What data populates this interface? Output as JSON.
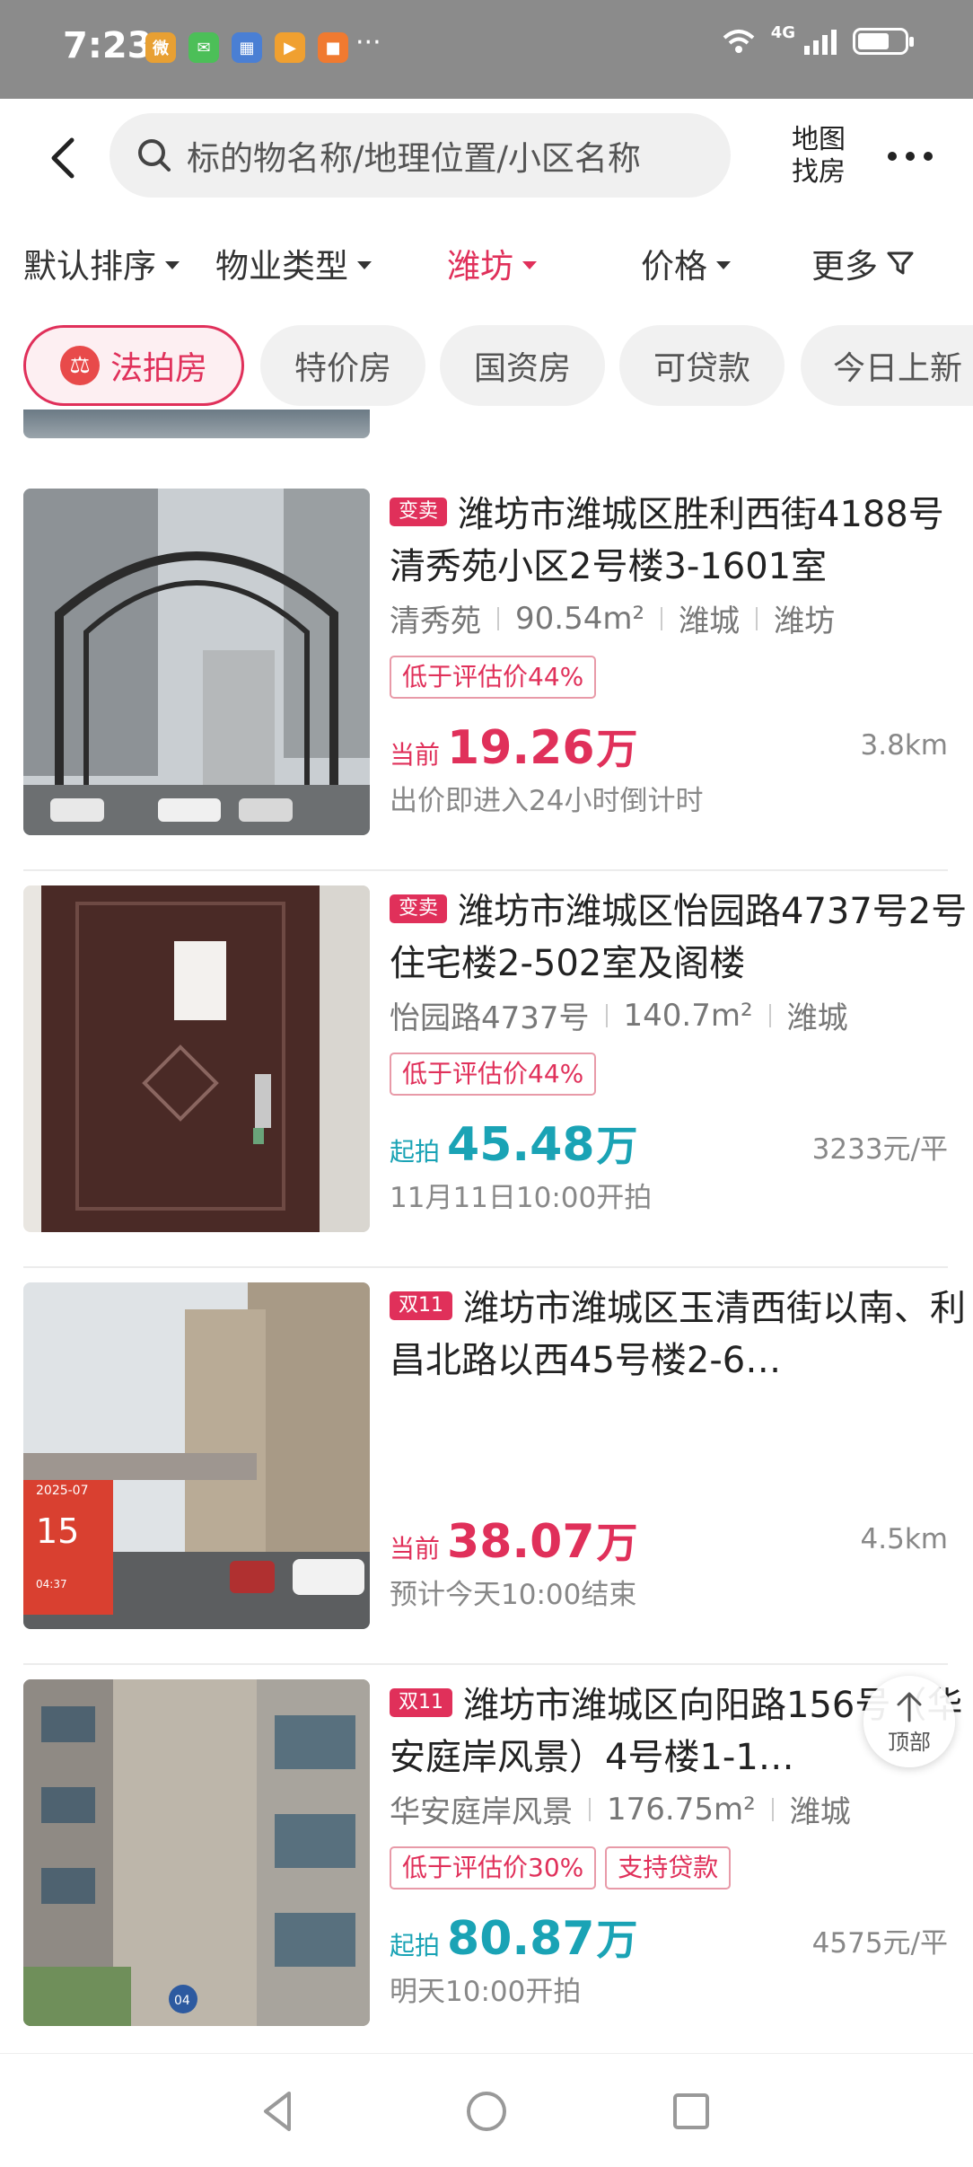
{
  "status_bar": {
    "time": "7:23",
    "network": "4G",
    "more_icons": "···",
    "apps": [
      "weibo-icon",
      "wechat-icon",
      "calendar-icon",
      "video-app-icon",
      "shopping-app-icon"
    ]
  },
  "top_bar": {
    "search_placeholder": "标的物名称/地理位置/小区名称",
    "map_button": "地图找房"
  },
  "filters": [
    {
      "label": "默认排序",
      "active": false
    },
    {
      "label": "物业类型",
      "active": false
    },
    {
      "label": "潍坊",
      "active": true
    },
    {
      "label": "价格",
      "active": false
    },
    {
      "label": "更多",
      "active": false
    }
  ],
  "tags": [
    {
      "label": "法拍房",
      "active": true
    },
    {
      "label": "特价房",
      "active": false
    },
    {
      "label": "国资房",
      "active": false
    },
    {
      "label": "可贷款",
      "active": false
    },
    {
      "label": "今日上新",
      "active": false
    }
  ],
  "listings": [
    {
      "badge": "变卖",
      "title": "潍坊市潍城区胜利西街4188号清秀苑小区2号楼3-1601室",
      "meta": [
        "清秀苑",
        "90.54m²",
        "潍城",
        "潍坊"
      ],
      "labels": [
        "低于评估价44%"
      ],
      "price_prefix": "当前",
      "price_value": "19.26",
      "price_unit": "万",
      "distance": "3.8km",
      "sub": "出价即进入24小时倒计时"
    },
    {
      "badge": "变卖",
      "title": "潍坊市潍城区怡园路4737号2号住宅楼2-502室及阁楼",
      "meta": [
        "怡园路4737号",
        "140.7m²",
        "潍城"
      ],
      "labels": [
        "低于评估价44%"
      ],
      "price_prefix": "起拍",
      "price_value": "45.48",
      "price_unit": "万",
      "distance": "3233元/平",
      "sub": "11月11日10:00开拍"
    },
    {
      "badge": "双11",
      "title": "潍坊市潍城区玉清西街以南、利昌北路以西45号楼2-6…",
      "meta": [],
      "labels": [],
      "price_prefix": "当前",
      "price_value": "38.07",
      "price_unit": "万",
      "distance": "4.5km",
      "sub": "预计今天10:00结束",
      "thumb_text": [
        "2025-07",
        "15",
        "04:37"
      ]
    },
    {
      "badge": "双11",
      "title": "潍坊市潍城区向阳路156号（华安庭岸风景）4号楼1-1…",
      "meta": [
        "华安庭岸风景",
        "176.75m²",
        "潍城"
      ],
      "labels": [
        "低于评估价30%",
        "支持贷款"
      ],
      "price_prefix": "起拍",
      "price_value": "80.87",
      "price_unit": "万",
      "distance": "4575元/平",
      "sub": "明天10:00开拍",
      "thumb_text": [
        "04"
      ]
    }
  ],
  "to_top_label": "顶部",
  "colors": {
    "accent": "#e0305a",
    "teal": "#1aa3b5"
  }
}
